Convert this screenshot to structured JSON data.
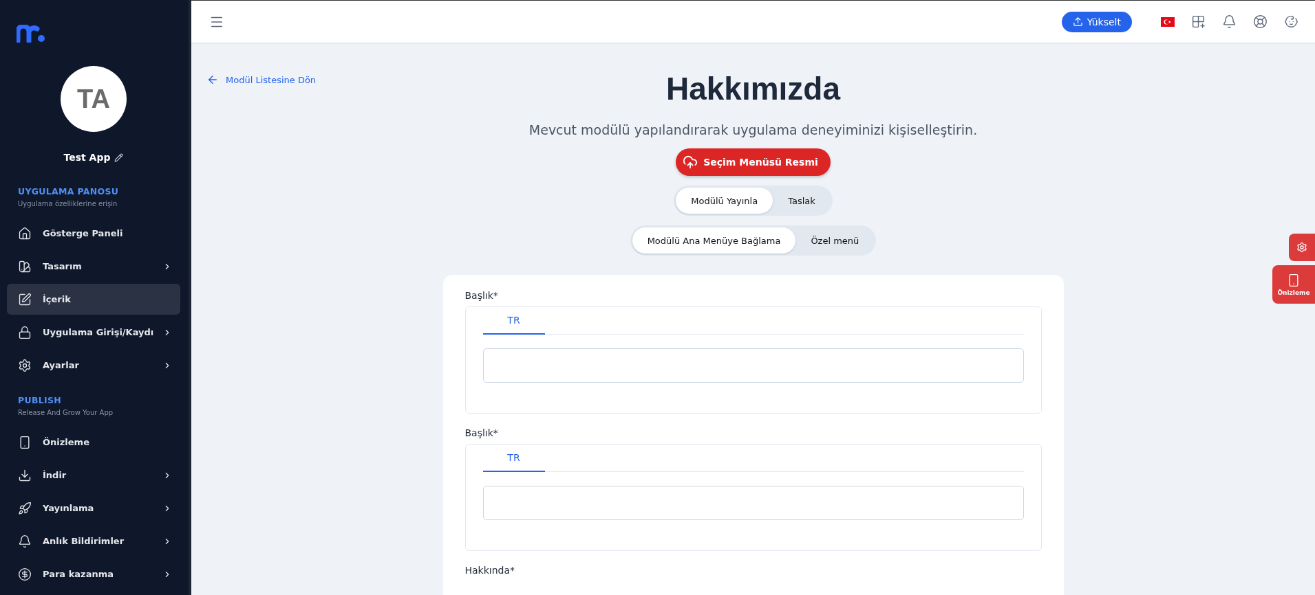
{
  "sidebar": {
    "app_name": "Test App",
    "avatar_initials": "TA",
    "sections": [
      {
        "title": "UYGULAMA PANOSU",
        "subtitle": "Uygulama özelliklerine erişin",
        "items": [
          {
            "label": "Gösterge Paneli",
            "selected": false,
            "expandable": false
          },
          {
            "label": "Tasarım",
            "selected": false,
            "expandable": true
          },
          {
            "label": "İçerik",
            "selected": true,
            "expandable": false
          },
          {
            "label": "Uygulama Girişi/Kaydı",
            "selected": false,
            "expandable": true
          },
          {
            "label": "Ayarlar",
            "selected": false,
            "expandable": true
          }
        ]
      },
      {
        "title": "PUBLISH",
        "subtitle": "Release And Grow Your App",
        "items": [
          {
            "label": "Önizleme",
            "selected": false,
            "expandable": false
          },
          {
            "label": "İndir",
            "selected": false,
            "expandable": true
          },
          {
            "label": "Yayınlama",
            "selected": false,
            "expandable": true
          },
          {
            "label": "Anlık Bildirimler",
            "selected": false,
            "expandable": true
          },
          {
            "label": "Para kazanma",
            "selected": false,
            "expandable": true
          }
        ]
      }
    ]
  },
  "topbar": {
    "upgrade_button": "Yükselt"
  },
  "back_link": "Modül Listesine Dön",
  "title": "Hakkımızda",
  "subtitle": "Mevcut modülü yapılandırarak uygulama deneyiminizi kişiselleştirin.",
  "image_button": "Seçim Menüsü Resmi",
  "toggles": [
    [
      {
        "label": "Modülü Yayınla",
        "selected": true
      },
      {
        "label": "Taslak",
        "selected": false
      }
    ],
    [
      {
        "label": "Modülü Ana Menüye Bağlama",
        "selected": true
      },
      {
        "label": "Özel menü",
        "selected": false
      }
    ]
  ],
  "fields": [
    {
      "label": "Başlık*",
      "tabs": [
        {
          "label": "TR",
          "selected": true
        }
      ]
    },
    {
      "label": "Başlık*",
      "tabs": [
        {
          "label": "TR",
          "selected": true
        }
      ]
    }
  ],
  "next_field_label": "Hakkında*",
  "side_buttons": {
    "preview": "Önizleme"
  }
}
